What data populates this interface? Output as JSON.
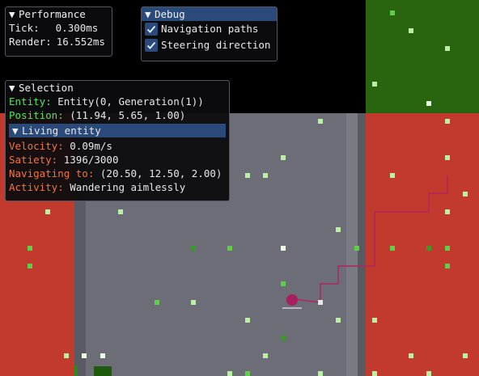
{
  "performance": {
    "title": "Performance",
    "tick_label": "Tick:",
    "tick_value": "0.300ms",
    "render_label": "Render:",
    "render_value": "16.552ms"
  },
  "debug": {
    "title": "Debug",
    "options": [
      {
        "label": "Navigation paths",
        "checked": true
      },
      {
        "label": "Steering direction",
        "checked": true
      }
    ]
  },
  "selection": {
    "title": "Selection",
    "entity_label": "Entity:",
    "entity_value": "Entity(0, Generation(1))",
    "position_label": "Position:",
    "position_value": "(11.94, 5.65, 1.00)",
    "living_header": "Living entity",
    "velocity_label": "Velocity:",
    "velocity_value": "0.09m/s",
    "satiety_label": "Satiety:",
    "satiety_value": "1396/3000",
    "navigating_label": "Navigating to:",
    "navigating_value": "(20.50, 12.50, 2.00)",
    "activity_label": "Activity:",
    "activity_value": "Wandering aimlessly"
  },
  "colors": {
    "grass": "#29650f",
    "red_zone": "#c13a2d",
    "stone": "#6d6d78",
    "path": "#b0245d",
    "agent": "#a91e5c",
    "accent": "#294a7a",
    "label_green": "#57e35a",
    "label_orange": "#f0763f"
  }
}
